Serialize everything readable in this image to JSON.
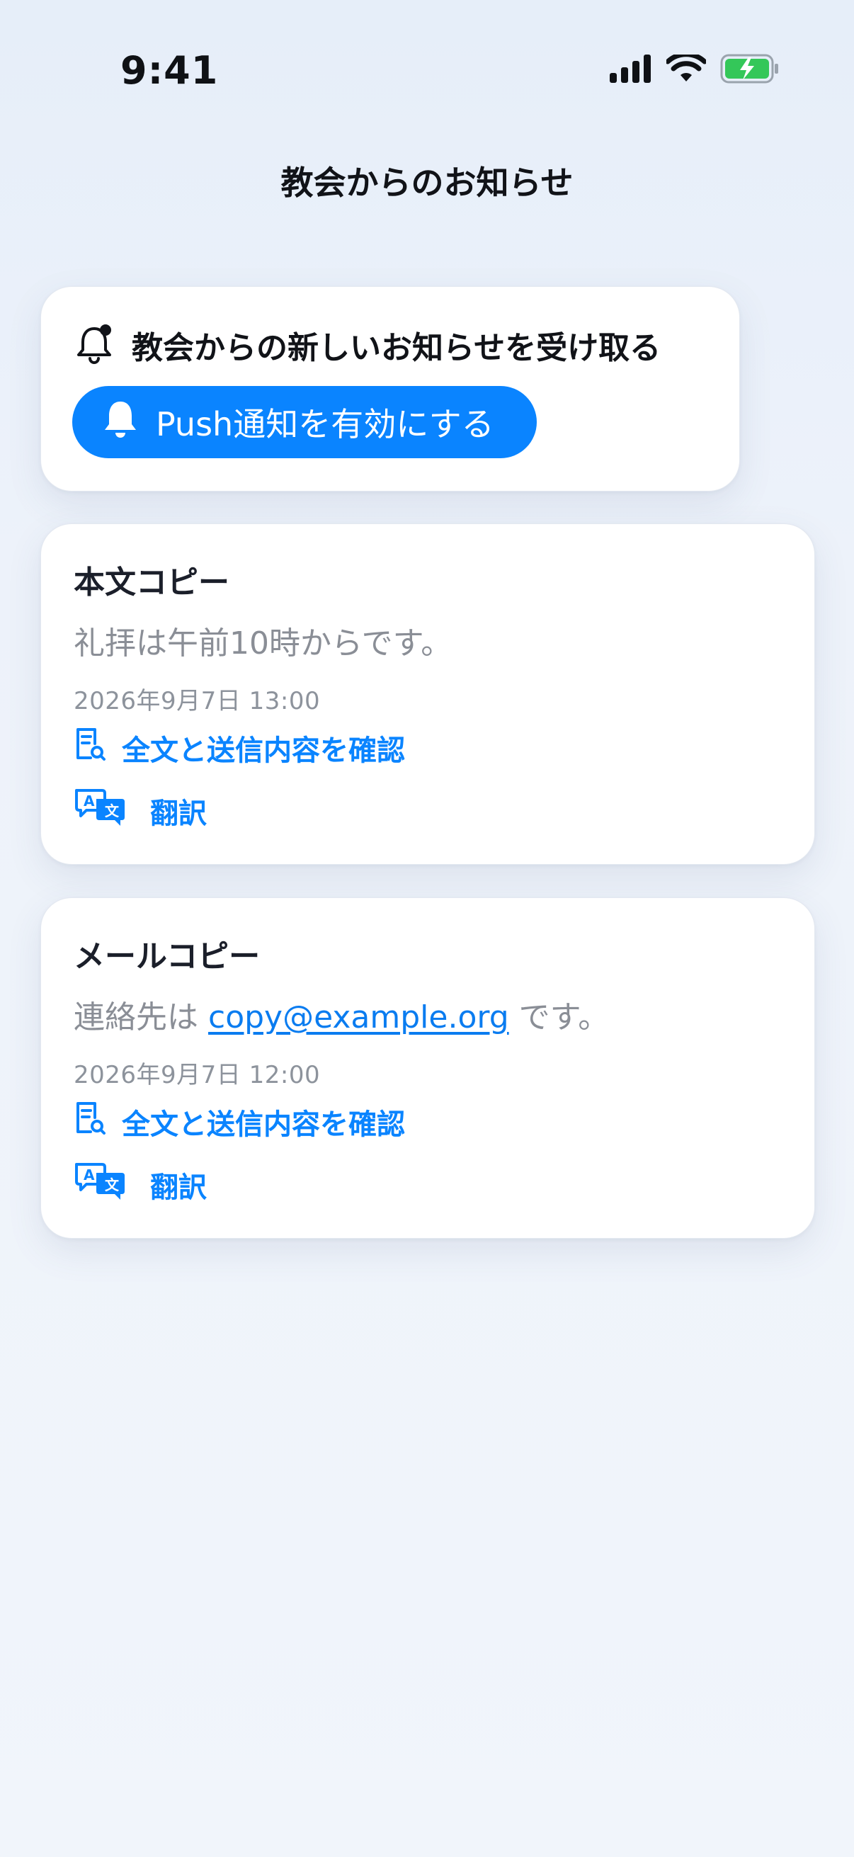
{
  "status_bar": {
    "time": "9:41"
  },
  "header": {
    "title": "教会からのお知らせ"
  },
  "push_card": {
    "heading": "教会からの新しいお知らせを受け取る",
    "button_label": "Push通知を有効にする"
  },
  "messages": [
    {
      "title": "本文コピー",
      "body": "礼拝は午前10時からです。",
      "date": "2026年9月7日 13:00",
      "action_view": "全文と送信内容を確認",
      "action_translate": "翻訳"
    },
    {
      "title": "メールコピー",
      "body_prefix": "連絡先は ",
      "body_link": "copy@example.org",
      "body_suffix": " です。",
      "date": "2026年9月7日 12:00",
      "action_view": "全文と送信内容を確認",
      "action_translate": "翻訳"
    }
  ],
  "colors": {
    "accent": "#0a84ff",
    "battery": "#34c759"
  }
}
